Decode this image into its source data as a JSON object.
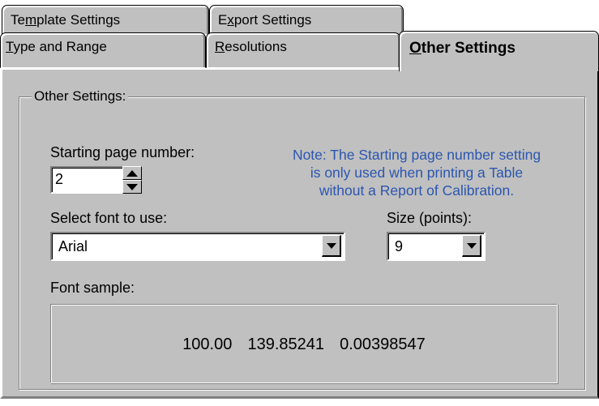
{
  "tabs": {
    "template": {
      "pre": "Te",
      "accel": "m",
      "post": "plate Settings"
    },
    "export": {
      "pre": "E",
      "accel": "x",
      "post": "port Settings"
    },
    "type_range": {
      "pre": "",
      "accel": "T",
      "post": "ype and Range"
    },
    "resolutions": {
      "pre": "",
      "accel": "R",
      "post": "esolutions"
    },
    "other": {
      "pre": "",
      "accel": "O",
      "post": "ther Settings"
    },
    "active": "other"
  },
  "group": {
    "title": "Other Settings:"
  },
  "starting_page": {
    "label": "Starting page number:",
    "value": "2"
  },
  "note": {
    "lines": [
      "Note: The Starting page number setting",
      "is only used when printing a Table",
      "without a Report of Calibration."
    ],
    "color": "#2b56b0"
  },
  "font": {
    "label": "Select font to use:",
    "value": "Arial"
  },
  "size": {
    "label": "Size (points):",
    "value": "9"
  },
  "sample": {
    "label": "Font sample:",
    "text": "100.00  139.85241  0.00398547"
  },
  "colors": {
    "face": "#c0c0c0",
    "highlight": "#ffffff",
    "shadow": "#808080",
    "dark": "#000000"
  },
  "icons": {
    "spin_up": "triangle-up-icon",
    "spin_down": "triangle-down-icon",
    "dropdown": "triangle-down-icon"
  }
}
